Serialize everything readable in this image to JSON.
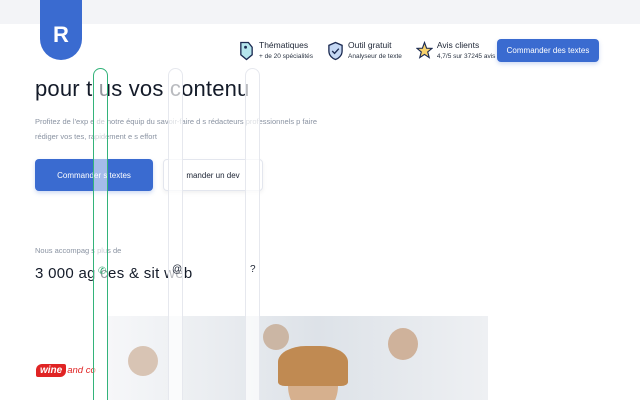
{
  "brand": {
    "logo_letter": "R",
    "accent": "#3a6bd0"
  },
  "nav": {
    "items": [
      {
        "icon": "tag-icon",
        "title": "Thématiques",
        "subtitle": "+ de 20 spécialités"
      },
      {
        "icon": "shield-check-icon",
        "title": "Outil gratuit",
        "subtitle": "Analyseur de texte"
      },
      {
        "icon": "star-icon",
        "title": "Avis clients",
        "subtitle": "4,7/5 sur 37245 avis"
      }
    ],
    "cta_label": "Commander des textes"
  },
  "hero": {
    "title": "pour t  us vos  contenu",
    "text": "Profitez de l'exp    e de notre équip    du savoir-faire d    s rédacteurs professionnels p    faire rédiger vos    tes, rapidement e    s effort",
    "cta_label": "Commander    s textes",
    "secondary_label": "mander un dev"
  },
  "stats": {
    "accompany_text": "Nous accompag    s plus de",
    "headline": "3 000 ag    ces & sit     web"
  },
  "floating": {
    "phone_glyph": "✆",
    "at_glyph": "@",
    "question_glyph": "?"
  },
  "clients": {
    "logo_badge": "wine",
    "logo_rest": "and co"
  }
}
